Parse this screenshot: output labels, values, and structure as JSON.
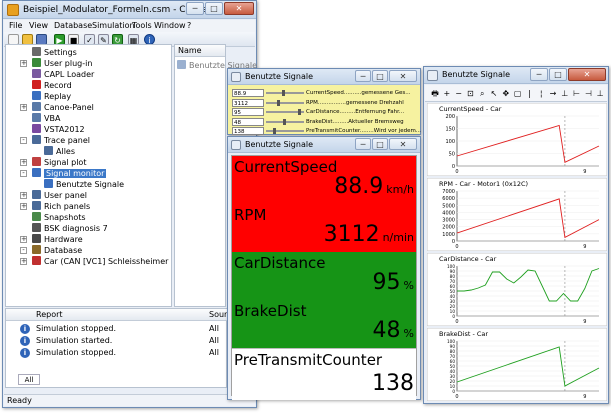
{
  "main_window": {
    "title": "Beispiel_Modulator_Formeln.csm - CanEasy",
    "menu": [
      "File",
      "View",
      "Database",
      "Simulation",
      "Tools",
      "Window",
      "?"
    ],
    "tree_items": [
      {
        "label": "Settings",
        "icon": "settings-icon",
        "color": "#6a6a6a"
      },
      {
        "label": "User plug-in",
        "icon": "plugin-icon",
        "color": "#3a8a3a"
      },
      {
        "label": "CAPL Loader",
        "icon": "capl-icon",
        "color": "#7a5aa0"
      },
      {
        "label": "Record",
        "icon": "record-icon",
        "color": "#d02020"
      },
      {
        "label": "Replay",
        "icon": "replay-icon",
        "color": "#3a6fc0"
      },
      {
        "label": "Canoe-Panel",
        "icon": "panel-icon",
        "color": "#5a7aa8"
      },
      {
        "label": "VBA",
        "icon": "vba-icon",
        "color": "#5a7aa8"
      },
      {
        "label": "VSTA2012",
        "icon": "vsta-icon",
        "color": "#7a4aa0"
      },
      {
        "label": "Trace panel",
        "icon": "trace-icon",
        "color": "#4a6a98"
      },
      {
        "label": "Alles",
        "icon": "trace-item-icon",
        "color": "#4a6a98"
      },
      {
        "label": "Signal plot",
        "icon": "plot-icon",
        "color": "#c04040"
      },
      {
        "label": "Signal monitor",
        "icon": "monitor-icon",
        "color": "#3a6fc0"
      },
      {
        "label": "Benutzte Signale",
        "icon": "monitor-item-icon",
        "color": "#3a6fc0"
      },
      {
        "label": "User panel",
        "icon": "user-panel-icon",
        "color": "#4a6a98"
      },
      {
        "label": "Rich panels",
        "icon": "rich-panel-icon",
        "color": "#4a6a98"
      },
      {
        "label": "Snapshots",
        "icon": "snapshot-icon",
        "color": "#4a8a4a"
      },
      {
        "label": "BSK diagnosis 7",
        "icon": "diagnosis-icon",
        "color": "#555555"
      },
      {
        "label": "Hardware",
        "icon": "hardware-icon",
        "color": "#4a4a4a"
      },
      {
        "label": "Database",
        "icon": "database-icon",
        "color": "#8a6a2a"
      },
      {
        "label": "Car (CAN [VC1] Schleissheimer - Virtual C",
        "icon": "car-icon",
        "color": "#c03030"
      }
    ],
    "name_panel": {
      "header": "Name",
      "item": "Benutzte Signale"
    },
    "report": {
      "headers": [
        "Report",
        "Source"
      ],
      "rows": [
        {
          "text": "Simulation stopped.",
          "source": "All"
        },
        {
          "text": "Simulation started.",
          "source": "All"
        },
        {
          "text": "Simulation stopped.",
          "source": "All"
        }
      ],
      "tab": "All"
    },
    "status": "Ready"
  },
  "signal_list_window": {
    "title": "Benutzte Signale",
    "rows": [
      {
        "value": "88.9",
        "name": "CurrentSpeed..........gemessene Ges...",
        "level": 0.45
      },
      {
        "value": "3112",
        "name": "RPM................gemessene Drehzahl",
        "level": 0.3
      },
      {
        "value": "95",
        "name": "CarDistance.........Entfernung Fahr...",
        "level": 0.9
      },
      {
        "value": "48",
        "name": "BrakeDist.........Aktueller Bremsweg",
        "level": 0.48
      },
      {
        "value": "138",
        "name": "PreTransmitCounter........Wird vor jedem...",
        "level": 0.2
      }
    ]
  },
  "monitor_window": {
    "title": "Benutzte Signale",
    "signals": [
      {
        "name": "CurrentSpeed",
        "value": "88.9",
        "unit": "km/h",
        "bg": "#ff0000"
      },
      {
        "name": "RPM",
        "value": "3112",
        "unit": "n/min",
        "bg": "#ff0000"
      },
      {
        "name": "CarDistance",
        "value": "95",
        "unit": "%",
        "bg": "#169416"
      },
      {
        "name": "BrakeDist",
        "value": "48",
        "unit": "%",
        "bg": "#169416"
      },
      {
        "name": "PreTransmitCounter",
        "value": "138",
        "unit": "",
        "bg": "#ffffff"
      }
    ]
  },
  "plot_window": {
    "title": "Benutzte Signale",
    "toolbar_icons": [
      "print-icon",
      "zoom-in-icon",
      "zoom-out-icon",
      "zoom-fit-icon",
      "magnify-icon",
      "cursor-icon",
      "move-icon",
      "select-icon",
      "marker-icon",
      "marker2-icon",
      "arrow-right-icon",
      "measure-icon",
      "align-left-icon",
      "align-right-icon",
      "align-both-icon"
    ]
  },
  "chart_data": [
    {
      "type": "line",
      "title": "CurrentSpeed - Car",
      "color": "#e02020",
      "ylim": [
        0,
        200
      ],
      "yticks": [
        0,
        50,
        100,
        150,
        200
      ],
      "xticks": [
        "0",
        "9"
      ],
      "x": [
        0,
        7.2,
        7.6,
        10
      ],
      "y": [
        40,
        162,
        15,
        80
      ]
    },
    {
      "type": "line",
      "title": "RPM - Car - Motor1 (0x12C)",
      "color": "#e02020",
      "ylim": [
        0,
        7000
      ],
      "yticks": [
        0,
        1000,
        2000,
        3000,
        4000,
        5000,
        6000,
        7000
      ],
      "xticks": [
        "0",
        "9"
      ],
      "x": [
        0,
        7.2,
        7.6,
        10
      ],
      "y": [
        1100,
        5900,
        500,
        3000
      ]
    },
    {
      "type": "line",
      "title": "CarDistance - Car",
      "color": "#20a020",
      "ylim": [
        0,
        100
      ],
      "yticks": [
        0,
        10,
        20,
        30,
        40,
        50,
        60,
        70,
        80,
        90,
        100
      ],
      "xticks": [
        "0",
        "9"
      ],
      "x": [
        0,
        0.5,
        1.0,
        1.5,
        2.0,
        2.5,
        3.0,
        3.5,
        4.0,
        4.5,
        5.0,
        5.5,
        6.0,
        6.5,
        7.0,
        7.5,
        8.0,
        8.5,
        9.0,
        9.5,
        10.0
      ],
      "y": [
        50,
        50,
        52,
        56,
        62,
        88,
        88,
        74,
        66,
        78,
        92,
        90,
        60,
        30,
        30,
        45,
        30,
        30,
        55,
        90,
        95
      ]
    },
    {
      "type": "line",
      "title": "BrakeDist - Car",
      "color": "#20a020",
      "ylim": [
        0,
        100
      ],
      "yticks": [
        0,
        10,
        20,
        30,
        40,
        50,
        60,
        70,
        80,
        90,
        100
      ],
      "xticks": [
        "0",
        "9"
      ],
      "x": [
        0,
        7.2,
        7.6,
        10
      ],
      "y": [
        18,
        88,
        10,
        46
      ]
    }
  ]
}
